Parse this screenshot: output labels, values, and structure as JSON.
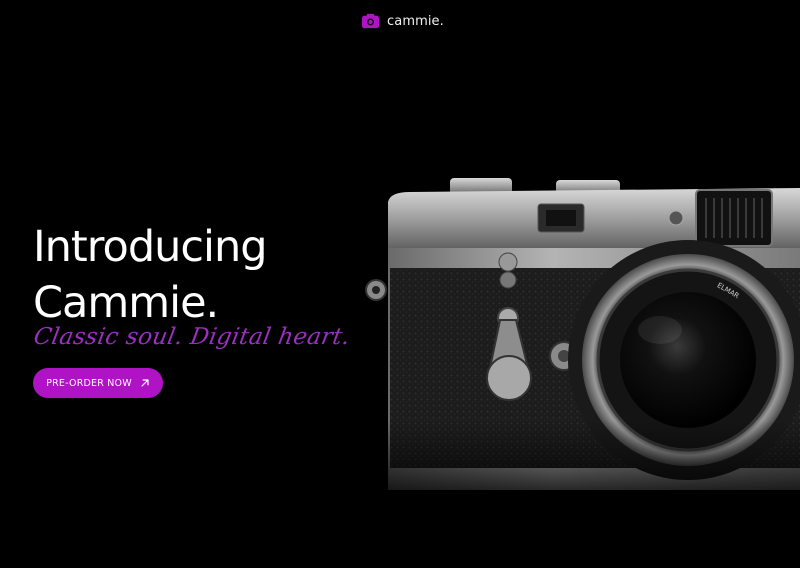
{
  "brand": {
    "name": "cammie.",
    "icon": "camera-icon",
    "accent_color": "#b012c6"
  },
  "hero": {
    "title_line1": "Introducing",
    "title_line2": "Cammie.",
    "tagline": "Classic soul. Digital heart.",
    "tagline_color": "#9b2fc2"
  },
  "cta": {
    "label": "PRE-ORDER NOW",
    "icon": "arrow-up-right-icon"
  },
  "product_image": {
    "icon": "camera-product-image"
  }
}
